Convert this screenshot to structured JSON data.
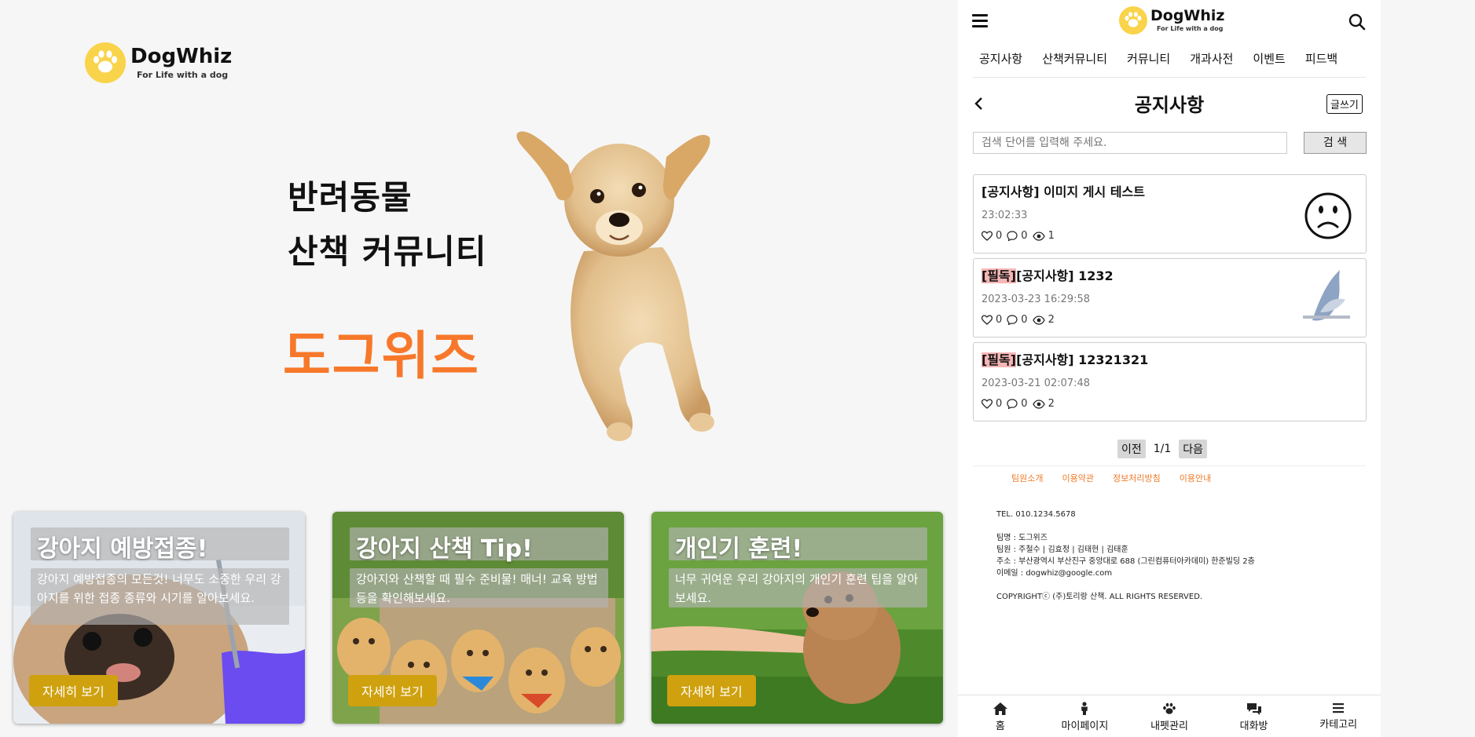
{
  "left": {
    "logo": {
      "brand": "DogWhiz",
      "tagline": "For Life with a dog"
    },
    "hero": {
      "line1": "반려동물",
      "line2": "산책 커뮤니티",
      "brand_ko": "도그위즈"
    },
    "cards": [
      {
        "title": "강아지 예방접종!",
        "desc": "강아지 예방접종의 모든것! 너무도 소중한 우리 강아지를 위한 접종 종류와 시기를 알아보세요.",
        "button": "자세히 보기"
      },
      {
        "title": "강아지 산책 Tip!",
        "desc": "강아지와 산책할 때 필수 준비물! 매너! 교육 방법 등을 확인해보세요.",
        "button": "자세히 보기"
      },
      {
        "title": "개인기 훈련!",
        "desc": "너무 귀여운 우리 강아지의 개인기 훈련 팁을 알아보세요.",
        "button": "자세히 보기"
      }
    ]
  },
  "panel": {
    "logo": {
      "brand": "DogWhiz",
      "tagline": "For Life with a dog"
    },
    "nav": [
      "공지사항",
      "산책커뮤니티",
      "커뮤니티",
      "개과사전",
      "이벤트",
      "피드백"
    ],
    "page_title": "공지사항",
    "write_button": "글쓰기",
    "search": {
      "placeholder": "검색 단어를 입력해 주세요.",
      "button": "검 색"
    },
    "posts": [
      {
        "pin": "",
        "title": "[공지사항] 이미지 게시 테스트",
        "time": "23:02:33",
        "likes": "0",
        "comments": "0",
        "views": "1"
      },
      {
        "pin": "[필독]",
        "title": "[공지사항] 1232",
        "time": "2023-03-23 16:29:58",
        "likes": "0",
        "comments": "0",
        "views": "2"
      },
      {
        "pin": "[필독]",
        "title": "[공지사항] 12321321",
        "time": "2023-03-21 02:07:48",
        "likes": "0",
        "comments": "0",
        "views": "2"
      }
    ],
    "pager": {
      "prev": "이전",
      "page": "1/1",
      "next": "다음"
    },
    "footer_links": [
      "팀원소개",
      "이용약관",
      "정보처리방침",
      "이용안내"
    ],
    "footer_info": {
      "tel": "TEL. 010.1234.5678",
      "team_name": "팀명 : 도그위즈",
      "members": "팀원 : 주철수 | 김효정 | 김태현 | 김태훈",
      "address": "주소 : 부산광역시 부산진구 중앙대로 688 (그린컴퓨터아카데미) 한준빌딩 2층",
      "email": "이메일 : dogwhiz@google.com",
      "copyright": "COPYRIGHTⓒ (주)토리랑 산책. ALL RIGHTS RESERVED."
    },
    "bottom_nav": [
      "홈",
      "마이페이지",
      "내펫관리",
      "대화방",
      "카테고리"
    ]
  },
  "colors": {
    "accent_orange": "#f7782a",
    "button_gold": "#cfa10e",
    "logo_yellow": "#f9d34a",
    "pin_pink": "#f6b6b6"
  },
  "icons": [
    "paw-logo-icon",
    "hamburger-icon",
    "search-icon",
    "chevron-left-icon",
    "heart-icon",
    "comment-icon",
    "eye-icon",
    "sad-face-icon",
    "home-icon",
    "person-icon",
    "paw-icon",
    "chat-bubbles-icon",
    "menu-icon"
  ]
}
